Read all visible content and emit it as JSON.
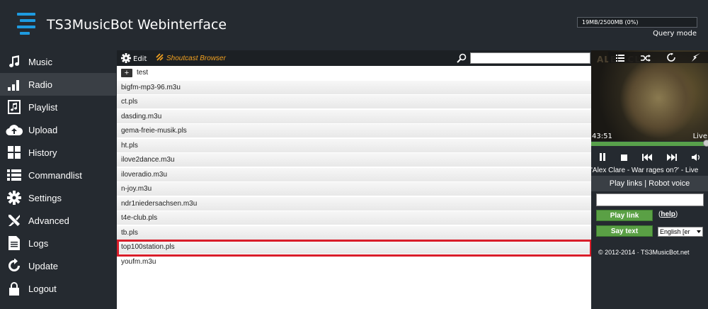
{
  "header": {
    "title": "TS3MusicBot Webinterface",
    "quota": "19MB/2500MB (0%)",
    "mode": "Query mode"
  },
  "sidebar": {
    "items": [
      {
        "label": "Music",
        "icon": "music-note-icon"
      },
      {
        "label": "Radio",
        "icon": "signal-bars-icon",
        "active": true
      },
      {
        "label": "Playlist",
        "icon": "playlist-icon"
      },
      {
        "label": "Upload",
        "icon": "cloud-upload-icon"
      },
      {
        "label": "History",
        "icon": "grid-icon"
      },
      {
        "label": "Commandlist",
        "icon": "list-icon"
      },
      {
        "label": "Settings",
        "icon": "gear-icon"
      },
      {
        "label": "Advanced",
        "icon": "tools-icon"
      },
      {
        "label": "Logs",
        "icon": "document-icon"
      },
      {
        "label": "Update",
        "icon": "refresh-icon"
      },
      {
        "label": "Logout",
        "icon": "lock-icon"
      }
    ]
  },
  "toolbar": {
    "edit_label": "Edit",
    "shoutcast_label": "Shoutcast Browser",
    "search_value": ""
  },
  "list": {
    "folder": "test",
    "files": [
      "bigfm-mp3-96.m3u",
      "ct.pls",
      "dasding.m3u",
      "gema-freie-musik.pls",
      "ht.pls",
      "ilove2dance.m3u",
      "iloveradio.m3u",
      "n-joy.m3u",
      "ndr1niedersachsen.m3u",
      "t4e-club.pls",
      "tb.pls",
      "top100station.pls",
      "youfm.m3u"
    ],
    "highlighted": "top100station.pls"
  },
  "player": {
    "cover_text": "ALEX CLA",
    "time_elapsed": "43:51",
    "time_status": "Live",
    "progress": 1.0,
    "now_playing": "'Alex Clare - War rages on?' - Live",
    "mode_bar": "Play links | Robot voice",
    "play_link_label": "Play link",
    "help_open": "(",
    "help_label": "help",
    "help_close": ")",
    "say_text_label": "Say text",
    "language": "English [er",
    "footer": "© 2012-2014 · TS3MusicBot.net"
  }
}
